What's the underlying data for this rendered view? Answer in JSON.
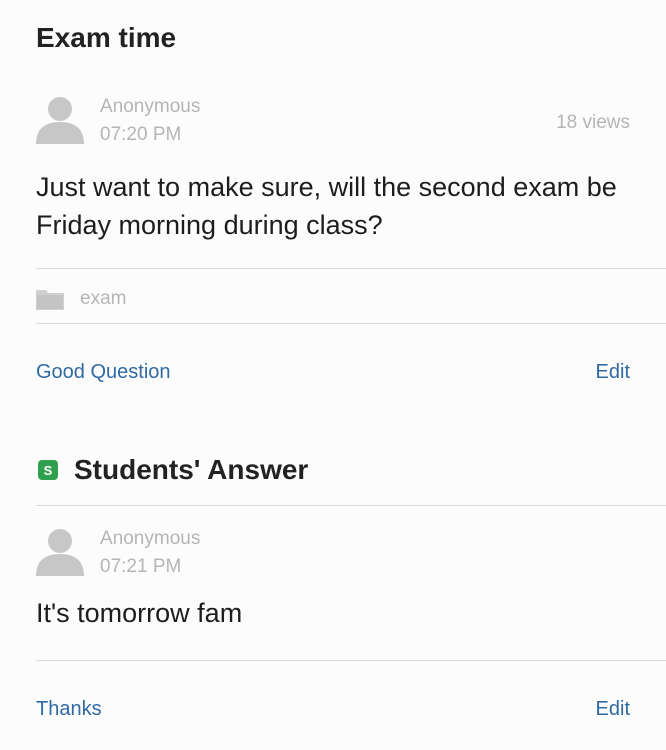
{
  "post": {
    "title": "Exam time",
    "author": "Anonymous",
    "time": "07:20 PM",
    "views": "18 views",
    "body": "Just want to make sure, will the second exam be Friday morning during class?",
    "folder_icon": "folder-icon",
    "tag": "exam",
    "good_question_label": "Good Question",
    "edit_label": "Edit"
  },
  "answer": {
    "badge": "S",
    "badge_color": "#2fa04f",
    "section_title": "Students' Answer",
    "author": "Anonymous",
    "time": "07:21 PM",
    "body": "It's tomorrow fam",
    "thanks_label": "Thanks",
    "edit_label": "Edit"
  },
  "colors": {
    "link": "#2f6aa3",
    "muted": "#b5b5b5"
  }
}
